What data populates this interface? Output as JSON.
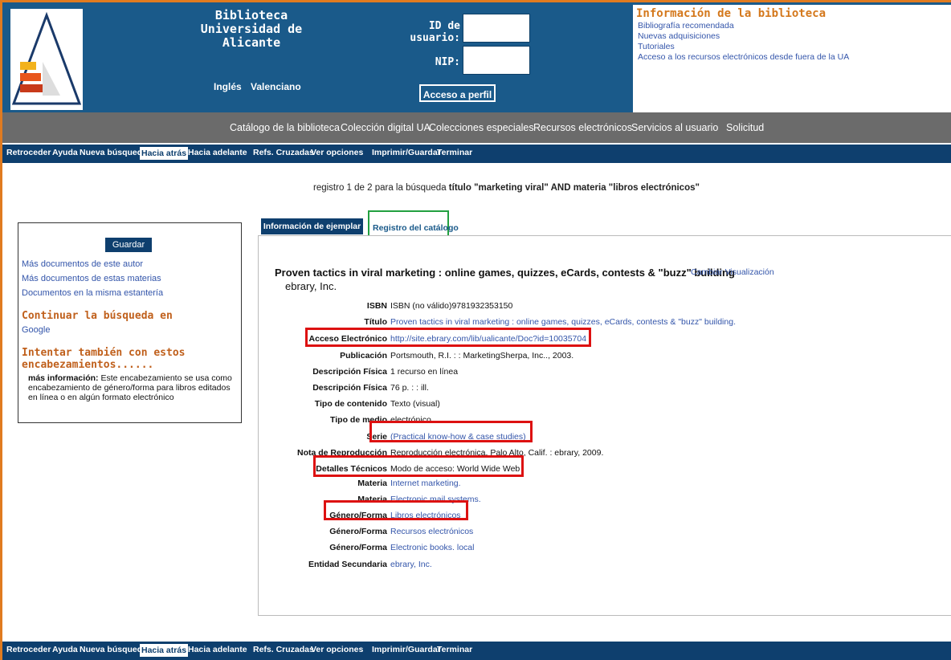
{
  "header": {
    "title_line1": "Biblioteca",
    "title_line2": "Universidad de Alicante",
    "lang_ingles": "Inglés",
    "lang_valenciano": "Valenciano",
    "user_id_label": "ID de usuario:",
    "nip_label": "NIP:",
    "acceso_label": "Acceso a perfil"
  },
  "info": {
    "title": "Información de la biblioteca",
    "links": [
      "Bibliografía recomendada",
      "Nuevas adquisiciones",
      "Tutoriales",
      "Acceso a los recursos electrónicos desde fuera de la UA"
    ]
  },
  "main_nav": [
    "Catálogo de la biblioteca",
    "Colección digital UA",
    "Colecciones especiales",
    "Recursos electrónicos",
    "Servicios al usuario",
    "Solicitud"
  ],
  "toolbar": [
    "Retroceder",
    "Ayuda",
    "Nueva búsqueda",
    "Hacia atrás",
    "Hacia adelante",
    "Refs. Cruzadas",
    "Ver opciones",
    "Imprimir/Guardar",
    "Terminar"
  ],
  "search_summary": {
    "prefix": "registro 1 de 2 para la búsqueda",
    "query": "título \"marketing viral\" AND materia \"libros electrónicos\""
  },
  "left_panel": {
    "guardar": "Guardar",
    "link1": "Más documentos de este autor",
    "link2": "Más documentos de estas materias",
    "link3": "Documentos en la misma estantería",
    "continuar": "Continuar la búsqueda en",
    "google": "Google",
    "intentar": "Intentar también con estos encabezamientos......",
    "mas_info_label": "más información:",
    "mas_info_text": "Este encabezamiento se usa como encabezamiento de género/forma para libros editados en línea o en algún formato electrónico"
  },
  "tabs": {
    "tab1": "Información de ejemplar",
    "tab2": "Registro del catálogo"
  },
  "record": {
    "title": "Proven tactics in viral marketing : online games, quizzes, eCards, contests & \"buzz\" building",
    "author": "ebrary, Inc.",
    "cambiar": "Cambiar Visualización",
    "fields": [
      {
        "label": "ISBN",
        "value": "ISBN (no válido)9781932353150"
      },
      {
        "label": "Título",
        "value": "Proven tactics in viral marketing : online games, quizzes, eCards, contests & \"buzz\" building."
      },
      {
        "label": "Acceso Electrónico",
        "value": "http://site.ebrary.com/lib/ualicante/Doc?id=10035704"
      },
      {
        "label": "Publicación",
        "value": "Portsmouth, R.I. : : MarketingSherpa, Inc.., 2003."
      },
      {
        "label": "Descripción Física",
        "value": "1 recurso en línea"
      },
      {
        "label": "Descripción Física",
        "value": "76 p. : : ill."
      },
      {
        "label": "Tipo de contenido",
        "value": "Texto (visual)"
      },
      {
        "label": "Tipo de medio",
        "value": "electrónico"
      },
      {
        "label": "Serie",
        "value": "(Practical know-how & case studies)"
      },
      {
        "label": "Nota de Reproducción",
        "value": "Reproducción electrónica. Palo Alto, Calif. : ebrary, 2009."
      },
      {
        "label": "Detalles Técnicos",
        "value": "Modo de acceso: World Wide Web"
      },
      {
        "label": "Materia",
        "value": "Internet marketing."
      },
      {
        "label": "Materia",
        "value": "Electronic mail systems."
      },
      {
        "label": "Género/Forma",
        "value": "Libros electrónicos"
      },
      {
        "label": "Género/Forma",
        "value": "Recursos electrónicos"
      },
      {
        "label": "Género/Forma",
        "value": "Electronic books. local"
      },
      {
        "label": "Entidad Secundaria",
        "value": "ebrary, Inc."
      }
    ]
  }
}
